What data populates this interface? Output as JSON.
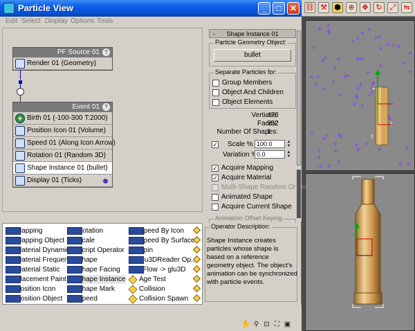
{
  "window": {
    "title": "Particle View",
    "minimize": "_",
    "maximize": "□",
    "close": "✕"
  },
  "menu": [
    "Edit",
    "Select",
    "Display",
    "Options",
    "Tools"
  ],
  "graph": {
    "source": {
      "title": "PF Source 01",
      "help": "?",
      "ops": [
        {
          "label": "Render 01 (Geometry)",
          "icon": "render-icon"
        }
      ]
    },
    "event": {
      "title": "Event 01",
      "help": "?",
      "ops": [
        {
          "label": "Birth 01 (-100-300 T:2000)",
          "icon": "birth-icon"
        },
        {
          "label": "Position Icon 01 (Volume)",
          "icon": "position-icon"
        },
        {
          "label": "Speed 01 (Along Icon Arrow)",
          "icon": "speed-icon"
        },
        {
          "label": "Rotation 01 (Random 3D)",
          "icon": "rotation-icon"
        },
        {
          "label": "Shape Instance 01 (bullet)",
          "icon": "shape-instance-icon"
        },
        {
          "label": "Display 01 (Ticks)",
          "icon": "display-icon"
        }
      ]
    }
  },
  "params": {
    "rollout": "Shape Instance 01",
    "rollout_toggle": "-",
    "geom_group": "Particle Geometry Object:",
    "geom_button": "bullet",
    "separate_group": "Separate Particles for:",
    "separate": [
      "Group Members",
      "Object And Children",
      "Object Elements"
    ],
    "stats": {
      "vertices_label": "Vertices:",
      "vertices": "476",
      "faces_label": "Faces:",
      "faces": "952",
      "shapes_label": "Number Of Shapes:",
      "shapes": "1"
    },
    "scale_label": "Scale %",
    "scale_value": "100.0",
    "variation_label": "Variation %",
    "variation_value": "0.0",
    "options": [
      {
        "label": "Acquire Mapping",
        "checked": true,
        "disabled": false
      },
      {
        "label": "Acquire Material",
        "checked": true,
        "disabled": false
      },
      {
        "label": "Multi-Shape Random Order",
        "checked": false,
        "disabled": true
      },
      {
        "label": "Animated Shape",
        "checked": false,
        "disabled": false
      },
      {
        "label": "Acquire Current Shape",
        "checked": false,
        "disabled": false
      }
    ],
    "anim_group": "Animation Offset Keying"
  },
  "depot": {
    "col1": [
      "Mapping",
      "Mapping Object",
      "Material Dynamic",
      "Material Frequency",
      "Material Static",
      "Placement Paint",
      "Position Icon",
      "Position Object"
    ],
    "col2": [
      "Rotation",
      "Scale",
      "Script Operator",
      "Shape",
      "Shape Facing",
      "Shape Instance",
      "Shape Mark",
      "Speed"
    ],
    "col3": [
      "Speed By Icon",
      "Speed By Surface",
      "Spin",
      "glu3DReader Op...",
      "pFlow -> glu3D",
      "Age Test",
      "Collision",
      "Collision Spawn"
    ]
  },
  "description": {
    "title": "Operator Description:",
    "text": "Shape Instance creates particles whose shape is based on a reference geometry object. The object's animation can be synchronized with particle events."
  },
  "colors": {
    "accent": "#0a5ee8",
    "event_dot": "#5a2ec0",
    "particles": "#7a3cff",
    "bullet": "#d9a75a"
  }
}
